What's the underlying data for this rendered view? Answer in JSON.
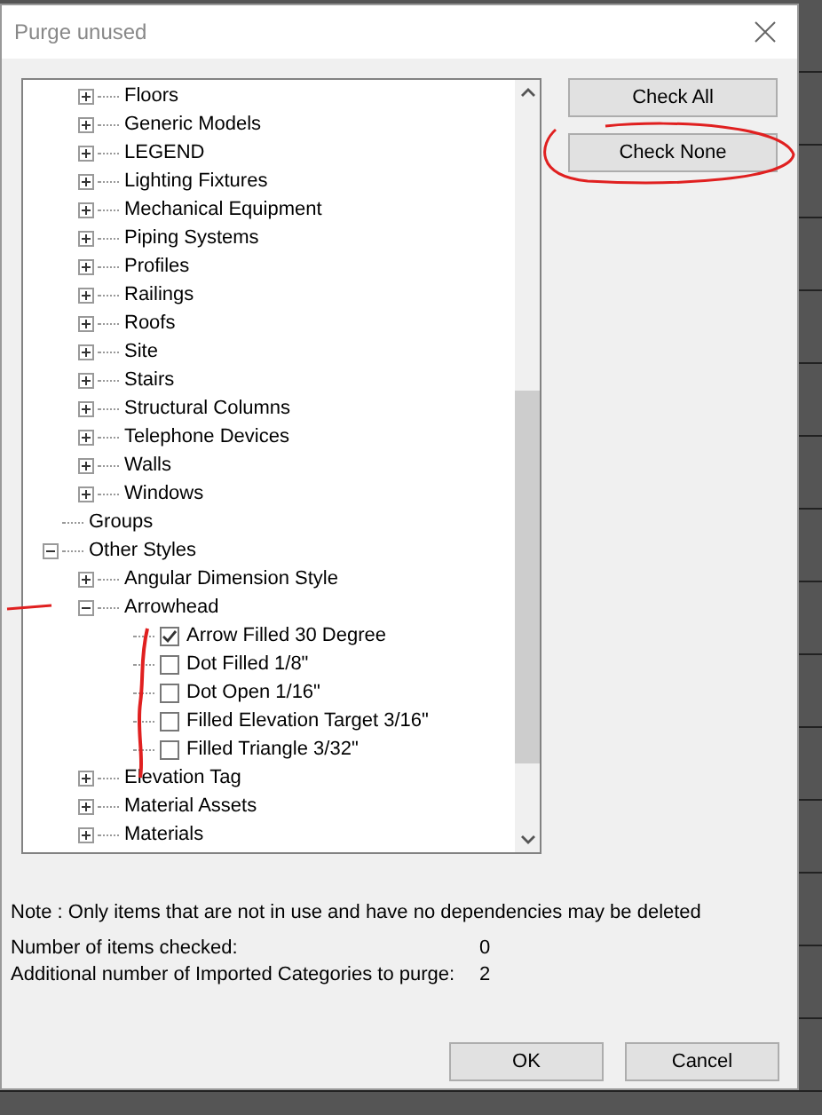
{
  "window": {
    "title": "Purge unused"
  },
  "tree": [
    {
      "kind": "parent",
      "children": [
        {
          "kind": "category",
          "label": "Floors",
          "expanded": false
        },
        {
          "kind": "category",
          "label": "Generic Models",
          "expanded": false
        },
        {
          "kind": "category",
          "label": "LEGEND",
          "expanded": false
        },
        {
          "kind": "category",
          "label": "Lighting Fixtures",
          "expanded": false
        },
        {
          "kind": "category",
          "label": "Mechanical Equipment",
          "expanded": false
        },
        {
          "kind": "category",
          "label": "Piping Systems",
          "expanded": false
        },
        {
          "kind": "category",
          "label": "Profiles",
          "expanded": false
        },
        {
          "kind": "category",
          "label": "Railings",
          "expanded": false
        },
        {
          "kind": "category",
          "label": "Roofs",
          "expanded": false
        },
        {
          "kind": "category",
          "label": "Site",
          "expanded": false
        },
        {
          "kind": "category",
          "label": "Stairs",
          "expanded": false
        },
        {
          "kind": "category",
          "label": "Structural Columns",
          "expanded": false
        },
        {
          "kind": "category",
          "label": "Telephone Devices",
          "expanded": false
        },
        {
          "kind": "category",
          "label": "Walls",
          "expanded": false
        },
        {
          "kind": "category",
          "label": "Windows",
          "expanded": false
        }
      ]
    },
    {
      "kind": "group",
      "label": "Groups"
    },
    {
      "kind": "category",
      "label": "Other Styles",
      "expanded": true,
      "children": [
        {
          "kind": "category",
          "label": "Angular Dimension Style",
          "expanded": false
        },
        {
          "kind": "category",
          "label": "Arrowhead",
          "expanded": true,
          "children": [
            {
              "kind": "item",
              "label": "Arrow Filled 30 Degree",
              "checked": true
            },
            {
              "kind": "item",
              "label": "Dot Filled 1/8\"",
              "checked": false
            },
            {
              "kind": "item",
              "label": "Dot Open 1/16\"",
              "checked": false
            },
            {
              "kind": "item",
              "label": "Filled Elevation Target 3/16\"",
              "checked": false
            },
            {
              "kind": "item",
              "label": "Filled Triangle 3/32\"",
              "checked": false
            }
          ]
        },
        {
          "kind": "category",
          "label": "Elevation Tag",
          "expanded": false
        },
        {
          "kind": "category",
          "label": "Material Assets",
          "expanded": false
        },
        {
          "kind": "category",
          "label": "Materials",
          "expanded": false
        }
      ]
    }
  ],
  "side_buttons": [
    "Check All",
    "Check None"
  ],
  "note": "Note : Only items that are not in use and have no dependencies may be deleted",
  "counts": [
    {
      "label": "Number of items checked:",
      "value": "0"
    },
    {
      "label": "Additional number of Imported Categories to purge:",
      "value": "2"
    }
  ],
  "buttons": [
    "OK",
    "Cancel"
  ]
}
